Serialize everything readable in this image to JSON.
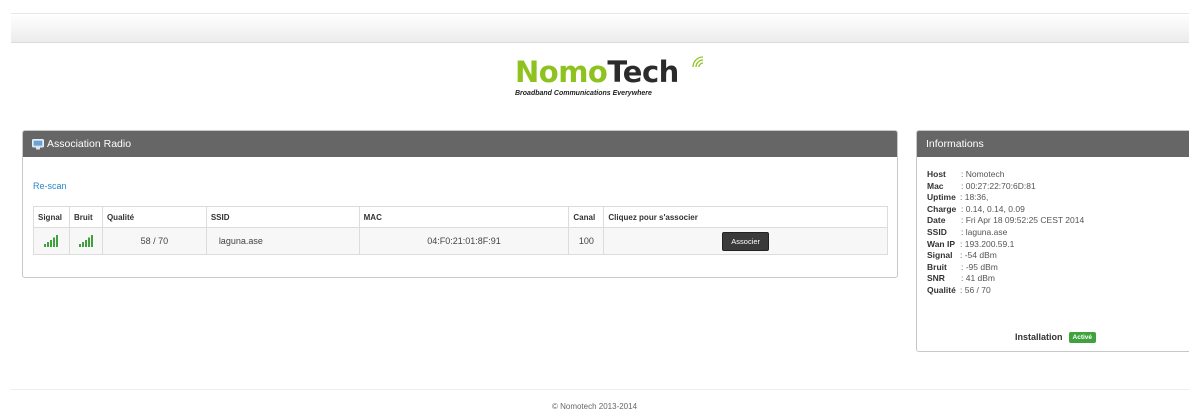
{
  "brand": {
    "name_part1": "Nomo",
    "name_part2": "Tech",
    "tagline": "Broadband Communications Everywhere"
  },
  "colors": {
    "brand_green": "#8ec31f",
    "panel_header": "#666666",
    "link": "#2a86c8",
    "badge_active": "#3fa23f",
    "button": "#3a3a3a"
  },
  "association": {
    "title": "Association Radio",
    "icon": "monitor-icon",
    "rescan_label": "Re-scan",
    "columns": [
      "Signal",
      "Bruit",
      "Qualité",
      "SSID",
      "MAC",
      "Canal",
      "Cliquez pour s'associer"
    ],
    "rows": [
      {
        "signal_icon": "signal-bars-icon",
        "noise_icon": "signal-bars-icon",
        "quality": "58 / 70",
        "ssid": "laguna.ase",
        "mac": "04:F0:21:01:8F:91",
        "channel": "100",
        "action_label": "Associer"
      }
    ]
  },
  "info": {
    "title": "Informations",
    "items": [
      {
        "key": "Host",
        "value": ": Nomotech"
      },
      {
        "key": "Mac",
        "value": ": 00:27:22:70:6D:81"
      },
      {
        "key": "Uptime",
        "value": ": 18:36,"
      },
      {
        "key": "Charge",
        "value": ": 0.14, 0.14, 0.09"
      },
      {
        "key": "Date",
        "value": ": Fri Apr 18 09:52:25 CEST 2014"
      },
      {
        "key": "SSID",
        "value": ": laguna.ase"
      },
      {
        "key": "Wan IP",
        "value": ": 193.200.59.1"
      },
      {
        "key": "Signal",
        "value": ": -54 dBm"
      },
      {
        "key": "Bruit",
        "value": ": -95 dBm"
      },
      {
        "key": "SNR",
        "value": ": 41 dBm"
      },
      {
        "key": "Qualité",
        "value": ": 56 / 70"
      }
    ],
    "install_label": "Installation",
    "install_badge": "Activé"
  },
  "footer": {
    "text": "© Nomotech 2013-2014"
  }
}
